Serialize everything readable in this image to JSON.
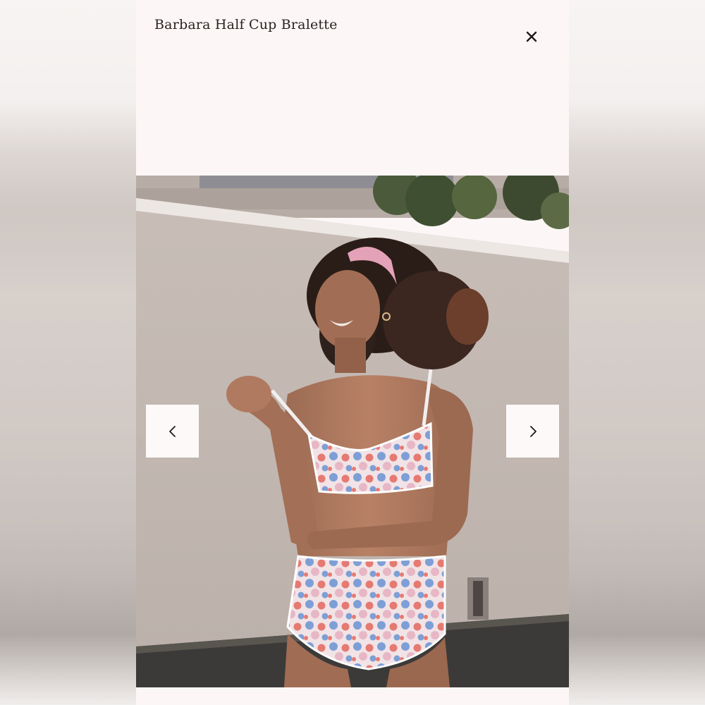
{
  "product": {
    "title": "Barbara Half Cup Bralette"
  },
  "icons": {
    "close": "close-icon",
    "previous": "chevron-left-icon",
    "next": "chevron-right-icon"
  },
  "colors": {
    "modal_background": "#fcf7f6",
    "title_text": "#2a2220",
    "nav_button_background": "#fcf9f8"
  }
}
